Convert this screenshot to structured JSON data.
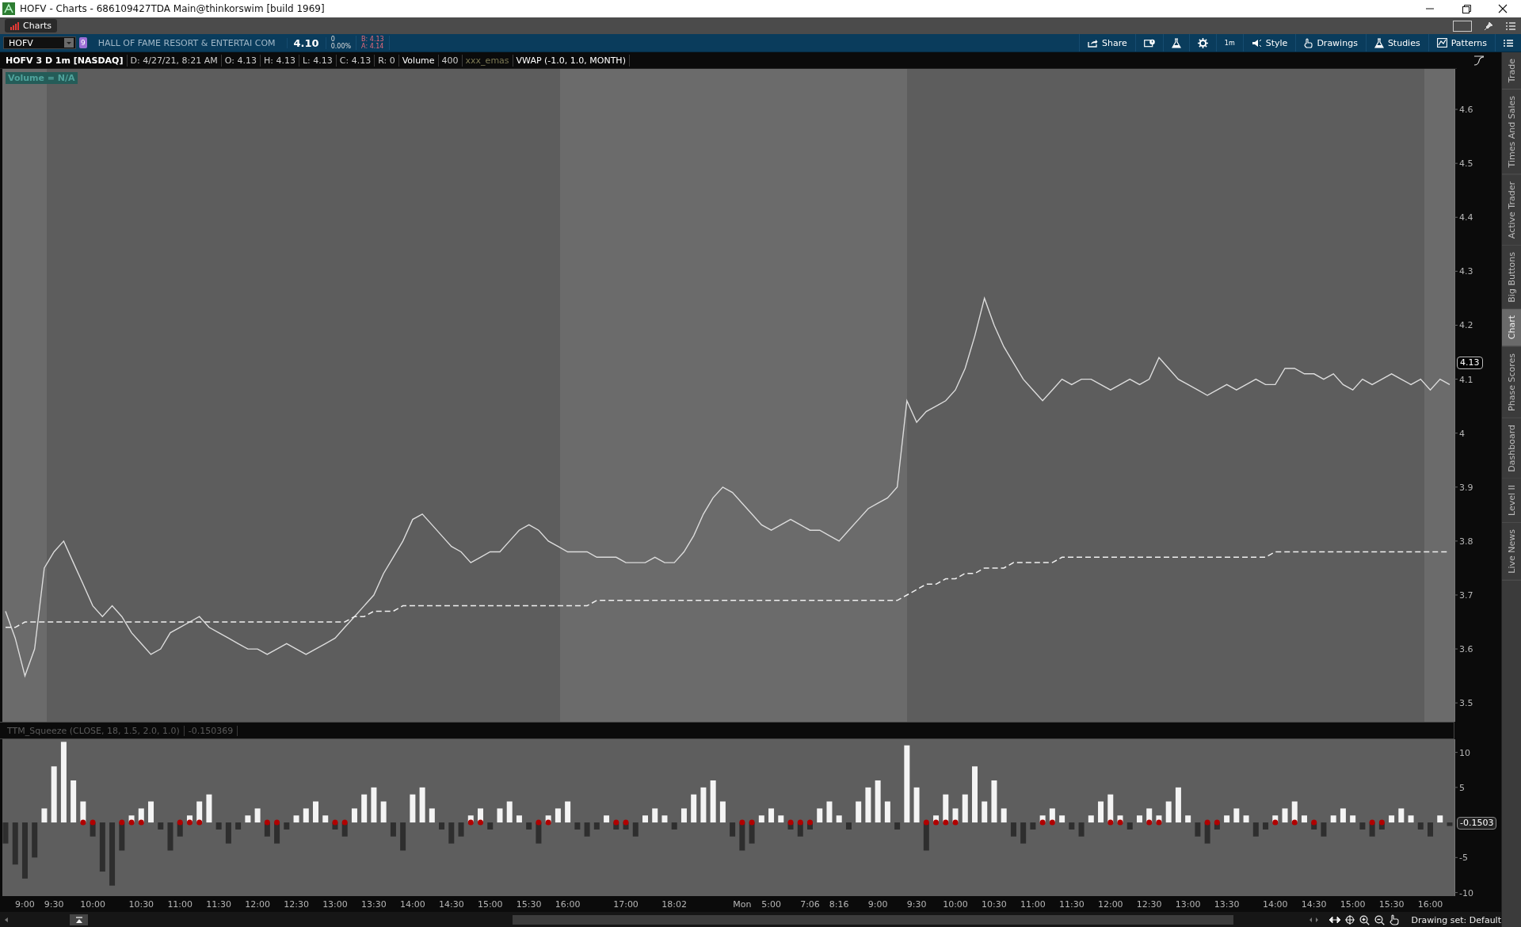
{
  "window": {
    "title": "HOFV - Charts - 686109427TDA Main@thinkorswim [build 1969]"
  },
  "tabs": [
    {
      "label": "Charts",
      "selected": true
    }
  ],
  "toolbar": {
    "symbol": "HOFV",
    "link_badge": "9",
    "company": "HALL OF FAME RESORT & ENTERTAI COM",
    "last": "4.10",
    "change": "0",
    "change_pct": "0.00%",
    "bid": "B: 4.13",
    "ask": "A: 4.14",
    "buttons": [
      {
        "kind": "share",
        "label": "Share"
      },
      {
        "kind": "alert"
      },
      {
        "kind": "flask"
      },
      {
        "kind": "gear"
      },
      {
        "kind": "text",
        "label": "1m"
      },
      {
        "kind": "style",
        "label": "Style"
      },
      {
        "kind": "drawings",
        "label": "Drawings"
      },
      {
        "kind": "studies",
        "label": "Studies"
      },
      {
        "kind": "patterns",
        "label": "Patterns"
      },
      {
        "kind": "menu"
      }
    ]
  },
  "info_bar": [
    {
      "kind": "title",
      "text": "HOFV 3 D 1m [NASDAQ]"
    },
    {
      "kind": "field",
      "text": "D: 4/27/21, 8:21 AM"
    },
    {
      "kind": "field",
      "text": "O: 4.13"
    },
    {
      "kind": "field",
      "text": "H: 4.13"
    },
    {
      "kind": "field",
      "text": "L: 4.13"
    },
    {
      "kind": "field",
      "text": "C: 4.13"
    },
    {
      "kind": "field",
      "text": "R: 0"
    },
    {
      "kind": "study",
      "text": "Volume"
    },
    {
      "kind": "field",
      "text": "400"
    },
    {
      "kind": "muted",
      "text": "xxx_emas"
    },
    {
      "kind": "study",
      "text": "VWAP (-1.0, 1.0, MONTH)"
    }
  ],
  "price_chart": {
    "volume_label": "Volume = N/A",
    "last_tag": "4.13",
    "chart_data": {
      "type": "line",
      "ylim": [
        3.465,
        4.675
      ],
      "yticks": [
        4.6,
        4.5,
        4.4,
        4.3,
        4.2,
        4.1,
        4,
        3.9,
        3.8,
        3.7,
        3.6,
        3.5
      ],
      "series": [
        {
          "color": "#dcdcdc",
          "line_style": "solid",
          "values": [
            3.67,
            3.62,
            3.55,
            3.6,
            3.75,
            3.78,
            3.8,
            3.76,
            3.72,
            3.68,
            3.66,
            3.68,
            3.66,
            3.63,
            3.61,
            3.59,
            3.6,
            3.63,
            3.64,
            3.65,
            3.66,
            3.64,
            3.63,
            3.62,
            3.61,
            3.6,
            3.6,
            3.59,
            3.6,
            3.61,
            3.6,
            3.59,
            3.6,
            3.61,
            3.62,
            3.64,
            3.66,
            3.68,
            3.7,
            3.74,
            3.77,
            3.8,
            3.84,
            3.85,
            3.83,
            3.81,
            3.79,
            3.78,
            3.76,
            3.77,
            3.78,
            3.78,
            3.8,
            3.82,
            3.83,
            3.82,
            3.8,
            3.79,
            3.78,
            3.78,
            3.78,
            3.77,
            3.77,
            3.77,
            3.76,
            3.76,
            3.76,
            3.77,
            3.76,
            3.76,
            3.78,
            3.81,
            3.85,
            3.88,
            3.9,
            3.89,
            3.87,
            3.85,
            3.83,
            3.82,
            3.83,
            3.84,
            3.83,
            3.82,
            3.82,
            3.81,
            3.8,
            3.82,
            3.84,
            3.86,
            3.87,
            3.88,
            3.9,
            4.06,
            4.02,
            4.04,
            4.05,
            4.06,
            4.08,
            4.12,
            4.18,
            4.25,
            4.2,
            4.16,
            4.13,
            4.1,
            4.08,
            4.06,
            4.08,
            4.1,
            4.09,
            4.1,
            4.1,
            4.09,
            4.08,
            4.09,
            4.1,
            4.09,
            4.1,
            4.14,
            4.12,
            4.1,
            4.09,
            4.08,
            4.07,
            4.08,
            4.09,
            4.08,
            4.09,
            4.1,
            4.09,
            4.09,
            4.12,
            4.12,
            4.11,
            4.11,
            4.1,
            4.11,
            4.09,
            4.08,
            4.1,
            4.09,
            4.1,
            4.11,
            4.1,
            4.09,
            4.1,
            4.08,
            4.1,
            4.09
          ]
        },
        {
          "color": "#f0f0f0",
          "line_style": "dashed",
          "values": [
            3.64,
            3.64,
            3.65,
            3.65,
            3.65,
            3.65,
            3.65,
            3.65,
            3.65,
            3.65,
            3.65,
            3.65,
            3.65,
            3.65,
            3.65,
            3.65,
            3.65,
            3.65,
            3.65,
            3.65,
            3.65,
            3.65,
            3.65,
            3.65,
            3.65,
            3.65,
            3.65,
            3.65,
            3.65,
            3.65,
            3.65,
            3.65,
            3.65,
            3.65,
            3.65,
            3.65,
            3.66,
            3.66,
            3.67,
            3.67,
            3.67,
            3.68,
            3.68,
            3.68,
            3.68,
            3.68,
            3.68,
            3.68,
            3.68,
            3.68,
            3.68,
            3.68,
            3.68,
            3.68,
            3.68,
            3.68,
            3.68,
            3.68,
            3.68,
            3.68,
            3.68,
            3.69,
            3.69,
            3.69,
            3.69,
            3.69,
            3.69,
            3.69,
            3.69,
            3.69,
            3.69,
            3.69,
            3.69,
            3.69,
            3.69,
            3.69,
            3.69,
            3.69,
            3.69,
            3.69,
            3.69,
            3.69,
            3.69,
            3.69,
            3.69,
            3.69,
            3.69,
            3.69,
            3.69,
            3.69,
            3.69,
            3.69,
            3.69,
            3.7,
            3.71,
            3.72,
            3.72,
            3.73,
            3.73,
            3.74,
            3.74,
            3.75,
            3.75,
            3.75,
            3.76,
            3.76,
            3.76,
            3.76,
            3.76,
            3.77,
            3.77,
            3.77,
            3.77,
            3.77,
            3.77,
            3.77,
            3.77,
            3.77,
            3.77,
            3.77,
            3.77,
            3.77,
            3.77,
            3.77,
            3.77,
            3.77,
            3.77,
            3.77,
            3.77,
            3.77,
            3.77,
            3.78,
            3.78,
            3.78,
            3.78,
            3.78,
            3.78,
            3.78,
            3.78,
            3.78,
            3.78,
            3.78,
            3.78,
            3.78,
            3.78,
            3.78,
            3.78,
            3.78,
            3.78,
            3.78
          ]
        }
      ]
    }
  },
  "squeeze_chart": {
    "title": "TTM_Squeeze (CLOSE, 18, 1.5, 2.0, 1.0)",
    "reading": "-0.150369",
    "last_tag": "-0.1503",
    "chart_data": {
      "type": "bar",
      "ylim": [
        -10.5,
        11.875
      ],
      "yticks": [
        10,
        5,
        -5,
        -10
      ],
      "series": [
        {
          "color": "#f4f4f4",
          "values": [
            null,
            null,
            null,
            null,
            2,
            8,
            11.5,
            6,
            3,
            null,
            null,
            null,
            null,
            1,
            2,
            3,
            null,
            null,
            null,
            1,
            3,
            4,
            null,
            null,
            null,
            1,
            2,
            null,
            null,
            null,
            1,
            2,
            3,
            1,
            null,
            null,
            2,
            4,
            5,
            3,
            null,
            null,
            4,
            5,
            2,
            null,
            null,
            null,
            1,
            2,
            null,
            2,
            3,
            1,
            null,
            null,
            1,
            2,
            3,
            null,
            null,
            null,
            1,
            null,
            null,
            null,
            1,
            2,
            1,
            null,
            2,
            4,
            5,
            6,
            3,
            null,
            null,
            null,
            1,
            2,
            1,
            null,
            null,
            null,
            2,
            3,
            1,
            null,
            3,
            5,
            6,
            3,
            null,
            11,
            5,
            null,
            1,
            4,
            2,
            4,
            8,
            3,
            6,
            2,
            null,
            null,
            null,
            1,
            2,
            1,
            null,
            null,
            1,
            3,
            4,
            1,
            null,
            1,
            2,
            1,
            3,
            5,
            1,
            null,
            null,
            null,
            1,
            2,
            1,
            null,
            null,
            1,
            2,
            3,
            1,
            null,
            null,
            1,
            2,
            1,
            null,
            null,
            null,
            1,
            2,
            1,
            null,
            null,
            1,
            null
          ]
        },
        {
          "color": "#2e2e2e",
          "values": [
            -3,
            -6,
            -8,
            -5,
            null,
            null,
            null,
            null,
            null,
            -2,
            -7,
            -9,
            -4,
            null,
            null,
            null,
            -1,
            -4,
            -2,
            null,
            null,
            null,
            -1,
            -3,
            -1,
            null,
            null,
            -2,
            -3,
            -1,
            null,
            null,
            null,
            null,
            -1,
            -2,
            null,
            null,
            null,
            null,
            -2,
            -4,
            null,
            null,
            null,
            -1,
            -3,
            -2,
            null,
            null,
            -1,
            null,
            null,
            null,
            -1,
            -3,
            null,
            null,
            null,
            -1,
            -2,
            -1,
            null,
            -1,
            -1,
            -2,
            null,
            null,
            null,
            -1,
            null,
            null,
            null,
            null,
            null,
            -2,
            -4,
            -3,
            null,
            null,
            null,
            -1,
            -2,
            -1,
            null,
            null,
            null,
            -1,
            null,
            null,
            null,
            null,
            -1,
            null,
            null,
            -4,
            null,
            null,
            null,
            null,
            null,
            null,
            null,
            null,
            -2,
            -3,
            -1,
            null,
            null,
            null,
            -1,
            -2,
            null,
            null,
            null,
            null,
            -1,
            null,
            null,
            null,
            null,
            null,
            null,
            -2,
            -3,
            -1,
            null,
            null,
            null,
            -2,
            -1,
            null,
            null,
            null,
            null,
            -1,
            -2,
            null,
            null,
            null,
            -1,
            -2,
            -1,
            null,
            null,
            null,
            -1,
            -2,
            null,
            -0.5
          ]
        },
        {
          "color": "#b00000",
          "values": [
            null,
            null,
            null,
            null,
            null,
            null,
            null,
            null,
            0,
            0,
            null,
            null,
            0,
            0,
            0,
            null,
            null,
            null,
            0,
            0,
            0,
            null,
            null,
            null,
            null,
            null,
            null,
            0,
            0,
            null,
            null,
            null,
            null,
            null,
            0,
            0,
            null,
            null,
            null,
            null,
            null,
            null,
            null,
            null,
            null,
            null,
            null,
            null,
            0,
            0,
            null,
            null,
            null,
            null,
            null,
            0,
            0,
            null,
            null,
            null,
            null,
            null,
            null,
            0,
            0,
            null,
            null,
            null,
            null,
            null,
            null,
            null,
            null,
            null,
            null,
            null,
            0,
            0,
            null,
            null,
            null,
            0,
            0,
            0,
            null,
            null,
            null,
            null,
            null,
            null,
            null,
            null,
            null,
            null,
            null,
            0,
            0,
            0,
            0,
            null,
            null,
            null,
            null,
            null,
            null,
            null,
            null,
            0,
            0,
            null,
            null,
            null,
            null,
            null,
            0,
            0,
            null,
            null,
            0,
            0,
            null,
            null,
            null,
            null,
            0,
            0,
            null,
            null,
            null,
            null,
            null,
            0,
            null,
            0,
            null,
            0,
            null,
            null,
            null,
            null,
            null,
            0,
            0,
            null,
            null,
            null,
            null,
            null,
            null,
            null
          ]
        }
      ]
    }
  },
  "time_axis": [
    "9:00",
    "9:30",
    "10:00",
    "10:30",
    "11:00",
    "11:30",
    "12:00",
    "12:30",
    "13:00",
    "13:30",
    "14:00",
    "14:30",
    "15:00",
    "15:30",
    "16:00",
    "17:00",
    "18:02",
    "Mon",
    "5:00",
    "7:06",
    "8:16",
    "9:00",
    "9:30",
    "10:00",
    "10:30",
    "11:00",
    "11:30",
    "12:00",
    "12:30",
    "13:00",
    "13:30",
    "14:00",
    "14:30",
    "15:00",
    "15:30",
    "16:00"
  ],
  "status_bar": {
    "drawing_set": "Drawing set: Default"
  },
  "side_tabs": [
    {
      "label": "Trade",
      "selected": false
    },
    {
      "label": "Times And Sales",
      "selected": false
    },
    {
      "label": "Active Trader",
      "selected": false
    },
    {
      "label": "Big Buttons",
      "selected": false
    },
    {
      "label": "Chart",
      "selected": true
    },
    {
      "label": "Phase Scores",
      "selected": false
    },
    {
      "label": "Dashboard",
      "selected": false
    },
    {
      "label": "Level II",
      "selected": false
    },
    {
      "label": "Live News",
      "selected": false
    }
  ]
}
